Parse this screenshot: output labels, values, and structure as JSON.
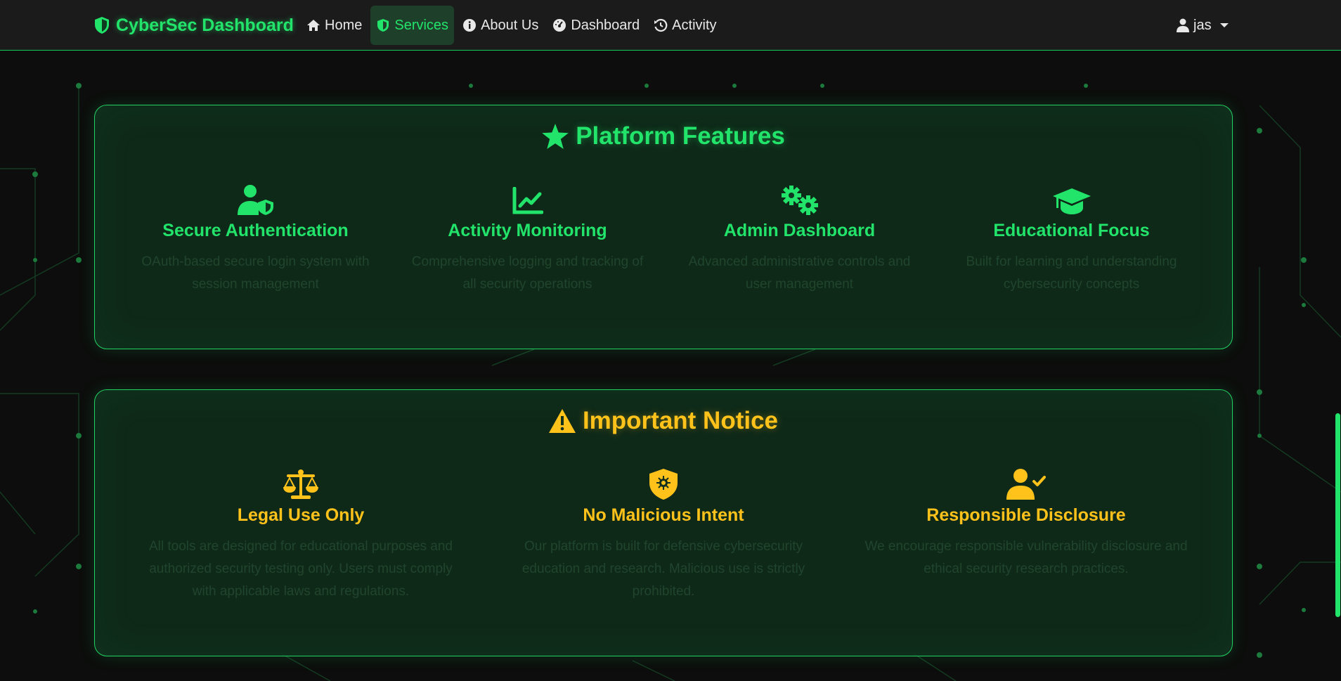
{
  "colors": {
    "accent": "#22e46b",
    "warning": "#ffc21a",
    "navbar": "#1b1b1b",
    "background": "#0c0d0c"
  },
  "navbar": {
    "brand": "CyberSec Dashboard",
    "links": [
      {
        "label": "Home",
        "icon": "home-icon"
      },
      {
        "label": "Services",
        "icon": "shield-icon",
        "active": true
      },
      {
        "label": "About Us",
        "icon": "info-icon"
      },
      {
        "label": "Dashboard",
        "icon": "gauge-icon"
      },
      {
        "label": "Activity",
        "icon": "history-icon"
      }
    ],
    "user": "jas"
  },
  "features": {
    "title": "Platform Features",
    "icon": "star-icon",
    "cards": [
      {
        "icon": "user-shield-icon",
        "title": "Secure Authentication",
        "desc": "OAuth-based secure login system with session management"
      },
      {
        "icon": "chart-line-icon",
        "title": "Activity Monitoring",
        "desc": "Comprehensive logging and tracking of all security operations"
      },
      {
        "icon": "gears-icon",
        "title": "Admin Dashboard",
        "desc": "Advanced administrative controls and user management"
      },
      {
        "icon": "graduation-cap-icon",
        "title": "Educational Focus",
        "desc": "Built for learning and understanding cybersecurity concepts"
      }
    ]
  },
  "notice": {
    "title": "Important Notice",
    "icon": "warning-icon",
    "cards": [
      {
        "icon": "scale-icon",
        "title": "Legal Use Only",
        "desc": "All tools are designed for educational purposes and authorized security testing only. Users must comply with applicable laws and regulations."
      },
      {
        "icon": "shield-virus-icon",
        "title": "No Malicious Intent",
        "desc": "Our platform is built for defensive cybersecurity education and research. Malicious use is strictly prohibited."
      },
      {
        "icon": "user-check-icon",
        "title": "Responsible Disclosure",
        "desc": "We encourage responsible vulnerability disclosure and ethical security research practices."
      }
    ]
  }
}
